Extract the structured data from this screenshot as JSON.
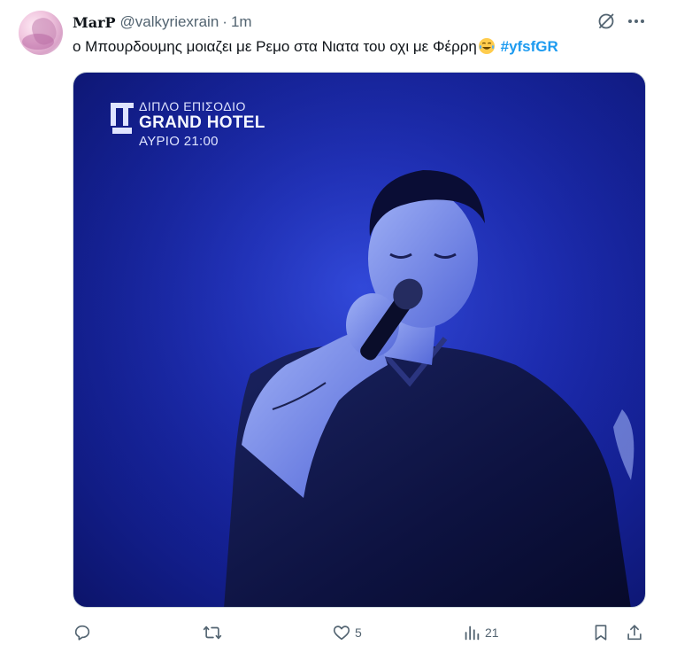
{
  "tweet": {
    "display_name": "MarP",
    "handle": "@valkyriexrain",
    "separator": "·",
    "time": "1m",
    "text_main": "ο Μπουρδουμης μοιαζει με Ρεμο στα Νιατα του οχι με Φέρρη",
    "emoji": "face-with-tears-of-joy",
    "hashtag": "#yfsfGR"
  },
  "media": {
    "overlay_top": "ΔΙΠΛΟ ΕΠΙΣΟΔΙΟ",
    "overlay_main": "GRAND HOTEL",
    "overlay_sub": "ΑΥΡΙΟ 21:00",
    "channel_logo": "ERT-logo",
    "dominant_color": "#1c2bb5"
  },
  "actions": {
    "reply_count": "",
    "retweet_count": "",
    "like_count": "5",
    "views_count": "21"
  },
  "colors": {
    "text": "#0f1419",
    "secondary": "#536471",
    "accent": "#1d9bf0",
    "border": "#cfd9de"
  }
}
